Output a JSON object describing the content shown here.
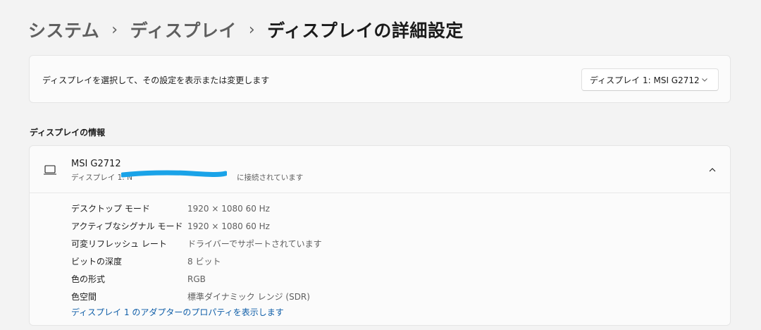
{
  "breadcrumb": {
    "items": [
      "システム",
      "ディスプレイ",
      "ディスプレイの詳細設定"
    ]
  },
  "select_card": {
    "description": "ディスプレイを選択して、その設定を表示または変更します",
    "dropdown_value": "ディスプレイ 1: MSI G2712"
  },
  "section": {
    "title": "ディスプレイの情報"
  },
  "monitor": {
    "name": "MSI G2712",
    "connection_prefix": "ディスプレイ 1: N",
    "connection_suffix": "に接続されています"
  },
  "info_rows": [
    {
      "label": "デスクトップ モード",
      "value": "1920 × 1080 60 Hz"
    },
    {
      "label": "アクティブなシグナル モード",
      "value": "1920 × 1080 60 Hz"
    },
    {
      "label": "可変リフレッシュ レート",
      "value": "ドライバーでサポートされています"
    },
    {
      "label": "ビットの深度",
      "value": "8 ビット"
    },
    {
      "label": "色の形式",
      "value": "RGB"
    },
    {
      "label": "色空間",
      "value": "標準ダイナミック レンジ (SDR)"
    }
  ],
  "adapter_link": "ディスプレイ 1 のアダプターのプロパティを表示します",
  "colors": {
    "background": "#f3f3f3",
    "card": "#fbfbfb",
    "link": "#0f5ea8",
    "redaction": "#1aa3e8"
  },
  "icons": {
    "separator": "chevron-right-icon",
    "dropdown": "chevron-down-icon",
    "monitor": "laptop-icon",
    "collapse": "chevron-up-icon"
  }
}
